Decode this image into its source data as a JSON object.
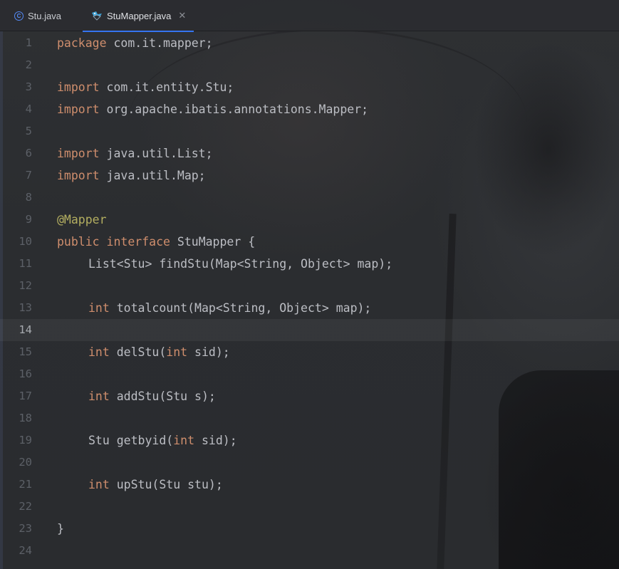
{
  "tabs": [
    {
      "label": "Stu.java",
      "icon": "class-icon",
      "active": false
    },
    {
      "label": "StuMapper.java",
      "icon": "mybatis-mapper-icon",
      "active": true
    }
  ],
  "editor": {
    "current_line": 14,
    "lines": [
      {
        "n": "1",
        "tokens": [
          {
            "t": "package",
            "k": "kw"
          },
          {
            "t": " com.it.mapper;",
            "k": ""
          }
        ]
      },
      {
        "n": "2",
        "tokens": []
      },
      {
        "n": "3",
        "tokens": [
          {
            "t": "import",
            "k": "kw"
          },
          {
            "t": " com.it.entity.Stu;",
            "k": ""
          }
        ]
      },
      {
        "n": "4",
        "tokens": [
          {
            "t": "import",
            "k": "kw"
          },
          {
            "t": " org.apache.ibatis.annotations.Mapper;",
            "k": ""
          }
        ]
      },
      {
        "n": "5",
        "tokens": []
      },
      {
        "n": "6",
        "tokens": [
          {
            "t": "import",
            "k": "kw"
          },
          {
            "t": " java.util.List;",
            "k": ""
          }
        ]
      },
      {
        "n": "7",
        "tokens": [
          {
            "t": "import",
            "k": "kw"
          },
          {
            "t": " java.util.Map;",
            "k": ""
          }
        ]
      },
      {
        "n": "8",
        "tokens": []
      },
      {
        "n": "9",
        "tokens": [
          {
            "t": "@Mapper",
            "k": "ann"
          }
        ]
      },
      {
        "n": "10",
        "tokens": [
          {
            "t": "public",
            "k": "kw"
          },
          {
            "t": " ",
            "k": ""
          },
          {
            "t": "interface",
            "k": "kw"
          },
          {
            "t": " StuMapper {",
            "k": ""
          }
        ]
      },
      {
        "n": "11",
        "indent": 1,
        "tokens": [
          {
            "t": "List<Stu> findStu(Map<String, Object> map);",
            "k": ""
          }
        ]
      },
      {
        "n": "12",
        "tokens": []
      },
      {
        "n": "13",
        "indent": 1,
        "tokens": [
          {
            "t": "int",
            "k": "kw"
          },
          {
            "t": " totalcount(Map<String, Object> map);",
            "k": ""
          }
        ]
      },
      {
        "n": "14",
        "tokens": []
      },
      {
        "n": "15",
        "indent": 1,
        "tokens": [
          {
            "t": "int",
            "k": "kw"
          },
          {
            "t": " delStu(",
            "k": ""
          },
          {
            "t": "int",
            "k": "kw"
          },
          {
            "t": " sid);",
            "k": ""
          }
        ]
      },
      {
        "n": "16",
        "tokens": []
      },
      {
        "n": "17",
        "indent": 1,
        "tokens": [
          {
            "t": "int",
            "k": "kw"
          },
          {
            "t": " addStu(Stu s);",
            "k": ""
          }
        ]
      },
      {
        "n": "18",
        "tokens": []
      },
      {
        "n": "19",
        "indent": 1,
        "tokens": [
          {
            "t": "Stu getbyid(",
            "k": ""
          },
          {
            "t": "int",
            "k": "kw"
          },
          {
            "t": " sid);",
            "k": ""
          }
        ]
      },
      {
        "n": "20",
        "tokens": []
      },
      {
        "n": "21",
        "indent": 1,
        "tokens": [
          {
            "t": "int",
            "k": "kw"
          },
          {
            "t": " upStu(Stu stu);",
            "k": ""
          }
        ]
      },
      {
        "n": "22",
        "tokens": []
      },
      {
        "n": "23",
        "tokens": [
          {
            "t": "}",
            "k": ""
          }
        ]
      },
      {
        "n": "24",
        "tokens": []
      }
    ]
  },
  "colors": {
    "keyword": "#cf8e6d",
    "annotation": "#b3ae60",
    "text": "#bcbec4",
    "line_number": "#5c6067",
    "tab_accent": "#3574f0"
  }
}
